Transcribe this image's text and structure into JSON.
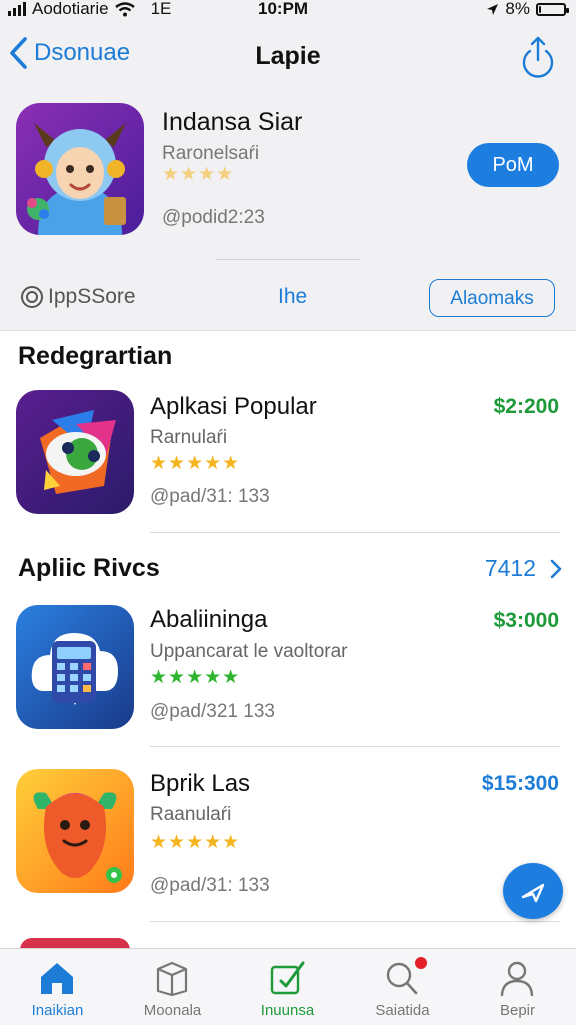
{
  "status_bar": {
    "carrier": "Aodotiarie",
    "network": "1E",
    "time": "10:PM",
    "battery": "8%",
    "battery_level": 0.08
  },
  "nav": {
    "back_label": "Dsonuae",
    "title": "Lapie"
  },
  "featured": {
    "name": "Indansa Siar",
    "subtitle": "Raronelsaŕi",
    "stars": "★★★★",
    "meta": "@podid2:23",
    "button_label": "PoM",
    "source_label": "IppSSore",
    "middle_tab_label": "Ihe",
    "outline_button_label": "Alaomaks"
  },
  "section1": {
    "title": "Redegrartian"
  },
  "section2": {
    "title": "Apliic Rivcs",
    "see_all_label": "7412"
  },
  "apps": [
    {
      "name": "Aplkasi Popular",
      "subtitle": "Rarnulaŕi",
      "stars": "★★★★★",
      "meta": "@pad/31: 133",
      "price": "$2:200",
      "price_color": "#1f9a39",
      "star_color": "#f5b520"
    },
    {
      "name": "Abaliininga",
      "subtitle": "Uppancarat le vaoltorar",
      "stars": "★★★★★",
      "meta": "@pad/321 133",
      "price": "$3:000",
      "price_color": "#1f9a39",
      "star_color": "#2fb52f"
    },
    {
      "name": "Bprik Las",
      "subtitle": "Raanulaŕi",
      "stars": "★★★★★",
      "meta": "@pad/31: 133",
      "price": "$15:300",
      "price_color": "#1c7cd6",
      "star_color": "#f5b520"
    }
  ],
  "tabs": [
    {
      "label": "Inaikian",
      "color": "#1c7cd6",
      "icon": "home-icon"
    },
    {
      "label": "Moonala",
      "color": "#777777",
      "icon": "box-icon"
    },
    {
      "label": "Inuunsa",
      "color": "#1f9a39",
      "icon": "edit-icon"
    },
    {
      "label": "Saiatida",
      "color": "#777777",
      "icon": "search-icon"
    },
    {
      "label": "Bepir",
      "color": "#777777",
      "icon": "person-icon"
    }
  ],
  "colors": {
    "accent": "#1c7cd6",
    "green": "#1f9a39",
    "badge": "#e4202a"
  }
}
